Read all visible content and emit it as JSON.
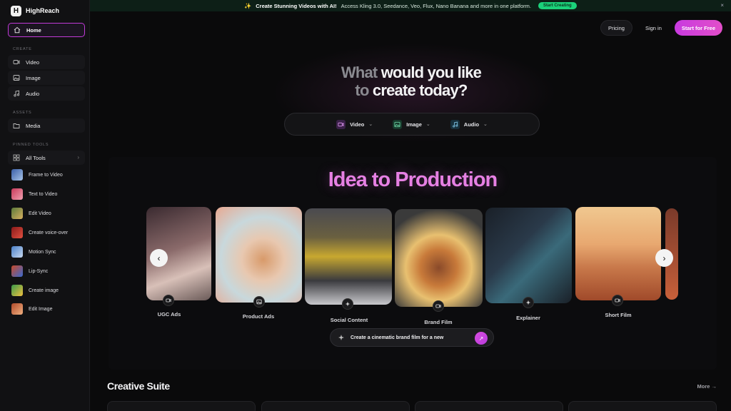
{
  "sidebar": {
    "brand": "HighReach",
    "home": "Home",
    "create_label": "CREATE",
    "create_items": [
      {
        "label": "Video",
        "icon": "video-icon"
      },
      {
        "label": "Image",
        "icon": "image-icon"
      },
      {
        "label": "Audio",
        "icon": "music-icon"
      }
    ],
    "assets_label": "ASSETS",
    "assets_items": [
      {
        "label": "Media",
        "icon": "folder-icon"
      }
    ],
    "pinned_label": "PINNED TOOLS",
    "all_tools": "All Tools",
    "tools": [
      {
        "label": "Frame to Video",
        "color": "#4a78c8"
      },
      {
        "label": "Text to Video",
        "color": "#d04a6a"
      },
      {
        "label": "Edit Video",
        "color": "#7c9a4a"
      },
      {
        "label": "Create voice-over",
        "color": "#c0392b"
      },
      {
        "label": "Motion Sync",
        "color": "#5a8ed0"
      },
      {
        "label": "Lip-Sync",
        "color": "#d06a3a"
      },
      {
        "label": "Create image",
        "color": "#6aa84f"
      },
      {
        "label": "Edit Image",
        "color": "#c8583a"
      }
    ]
  },
  "banner": {
    "spark": "✨",
    "headline": "Create Stunning Videos with AI!",
    "text": "Access Kling 3.0, Seedance, Veo, Flux, Nano Banana and more in one platform.",
    "button": "Start Creating",
    "close": "×"
  },
  "topnav": {
    "pricing": "Pricing",
    "signin": "Sign in",
    "start": "Start for Free"
  },
  "hero": {
    "line1_dim": "What",
    "line1_bright": "would you like",
    "line2_dim": "to",
    "line2_bright": "create today?",
    "modes": [
      {
        "label": "Video",
        "icon": "video-icon",
        "color": "#4a2a5a"
      },
      {
        "label": "Image",
        "icon": "image-icon",
        "color": "#1f4a3a"
      },
      {
        "label": "Audio",
        "icon": "music-icon",
        "color": "#1f3a4a"
      }
    ]
  },
  "production": {
    "title": "Idea to Production",
    "cards": [
      {
        "label": "UGC Ads",
        "icon": "video-icon"
      },
      {
        "label": "Product Ads",
        "icon": "image-icon"
      },
      {
        "label": "Social Content",
        "icon": "sparkle-icon"
      },
      {
        "label": "Brand Film",
        "icon": "video-icon"
      },
      {
        "label": "Explainer",
        "icon": "sparkle-icon"
      },
      {
        "label": "Short Film",
        "icon": "video-icon"
      }
    ],
    "prev": "‹",
    "next": "›",
    "prompt": "Create a cinematic brand film for a new",
    "send": "↗"
  },
  "suite": {
    "title": "Creative Suite",
    "more": "More →"
  }
}
